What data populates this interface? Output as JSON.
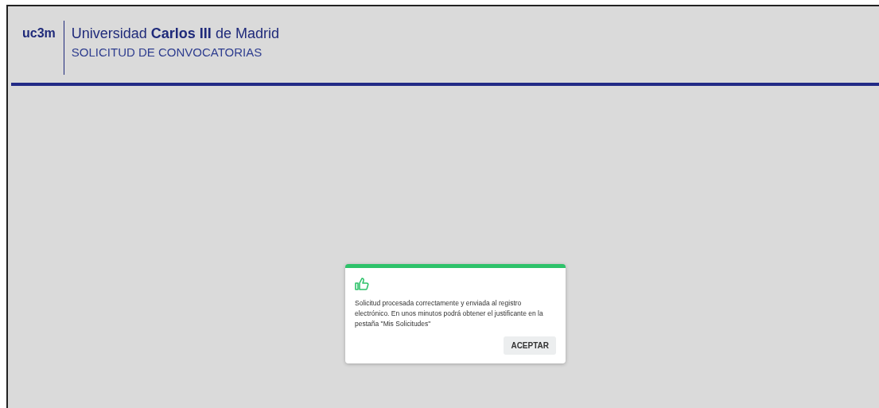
{
  "header": {
    "logo": "uc3m",
    "university": "Universidad **Carlos III** de Madrid",
    "subtitle": "SOLICITUD DE CONVOCATORIAS"
  },
  "dialog": {
    "message": "Solicitud procesada correctamente y enviada al registro electrónico. En unos minutos podrá obtener el justificante en la pestaña \"Mis Solicitudes\"",
    "button": "ACEPTAR"
  }
}
